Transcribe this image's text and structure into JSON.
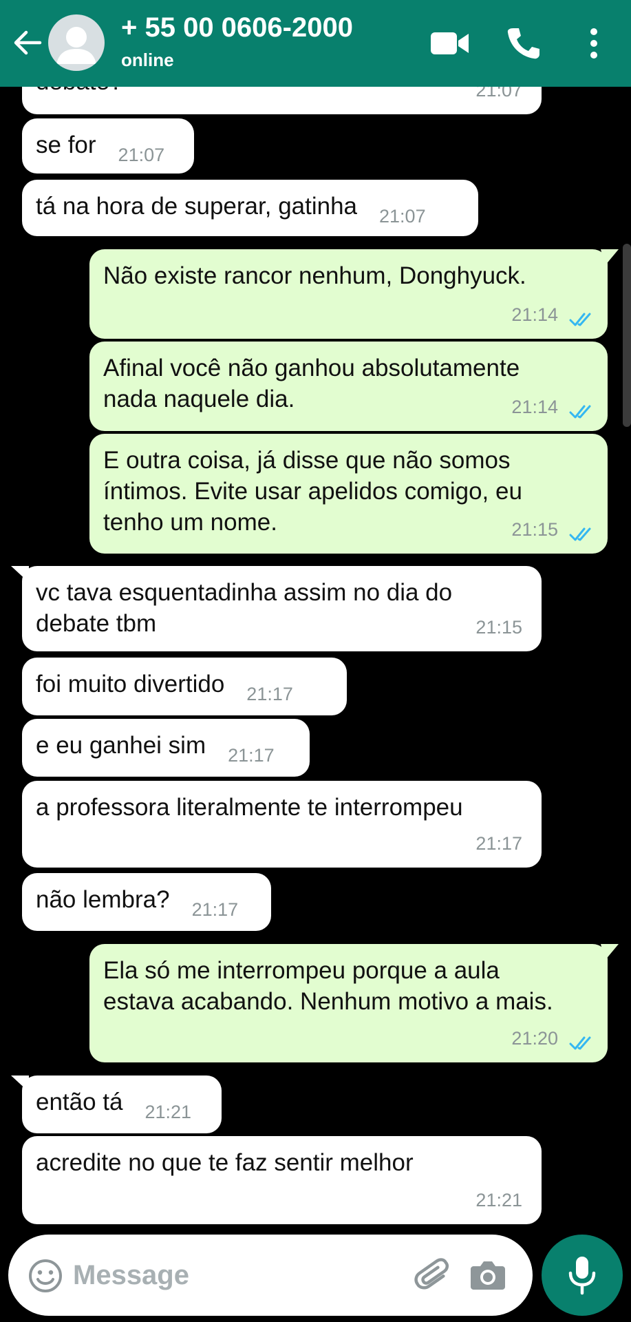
{
  "header": {
    "contact_name": "+ 55 00 0606-2000",
    "status": "online",
    "icons": [
      "back-arrow-icon",
      "avatar",
      "video-call-icon",
      "phone-icon",
      "more-options-icon"
    ]
  },
  "colors": {
    "header": "#08806d",
    "incoming_bubble": "#ffffff",
    "outgoing_bubble": "#e2fdd0",
    "read_ticks": "#34b7f1",
    "background": "#000000"
  },
  "messages": [
    {
      "dir": "in",
      "text": "debate?",
      "time": "21:07"
    },
    {
      "dir": "in",
      "text": "se for",
      "time": "21:07"
    },
    {
      "dir": "in",
      "text": "tá na hora de superar, gatinha",
      "time": "21:07"
    },
    {
      "dir": "out",
      "text": "Não existe rancor nenhum, Donghyuck.",
      "time": "21:14"
    },
    {
      "dir": "out",
      "text": "Afinal você não ganhou absolutamente\nnada naquele dia.",
      "time": "21:14"
    },
    {
      "dir": "out",
      "text": "E outra coisa, já disse que não somos\níntimos. Evite usar apelidos comigo, eu\ntenho um nome.",
      "time": "21:15"
    },
    {
      "dir": "in",
      "text": "vc tava esquentadinha assim no dia do\ndebate tbm",
      "time": "21:15"
    },
    {
      "dir": "in",
      "text": "foi muito divertido",
      "time": "21:17"
    },
    {
      "dir": "in",
      "text": "e eu ganhei sim",
      "time": "21:17"
    },
    {
      "dir": "in",
      "text": "a professora literalmente te interrompeu",
      "time": "21:17"
    },
    {
      "dir": "in",
      "text": "não lembra?",
      "time": "21:17"
    },
    {
      "dir": "out",
      "text": "Ela só me interrompeu porque a aula\nestava acabando. Nenhum motivo a mais.",
      "time": "21:20"
    },
    {
      "dir": "in",
      "text": "então tá",
      "time": "21:21"
    },
    {
      "dir": "in",
      "text": "acredite no que te faz sentir melhor",
      "time": "21:21"
    }
  ],
  "composer": {
    "placeholder": "Message",
    "icons": [
      "emoji-icon",
      "attach-icon",
      "camera-icon",
      "mic-icon"
    ]
  }
}
